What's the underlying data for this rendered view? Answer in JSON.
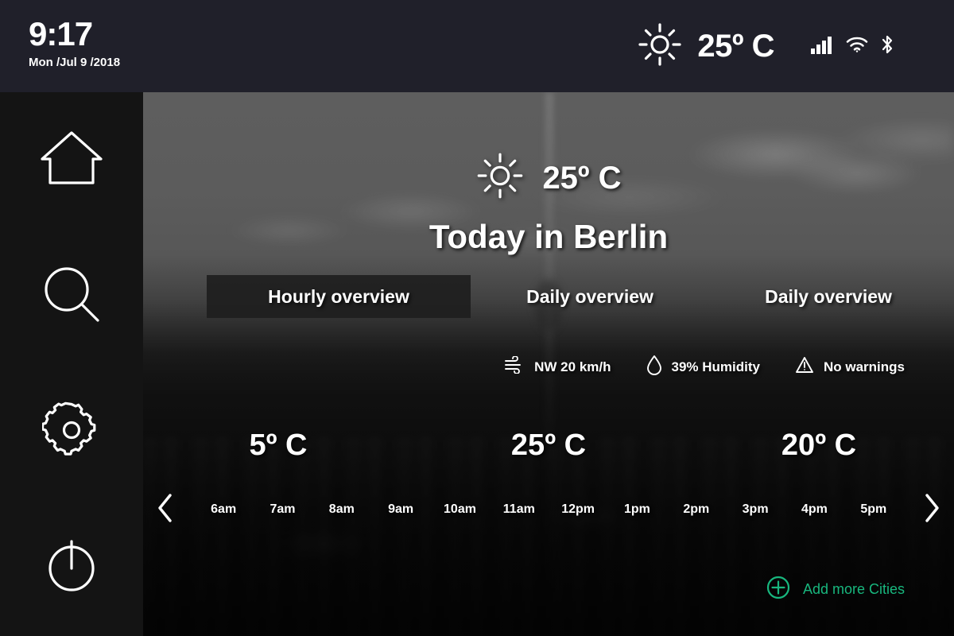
{
  "statusbar": {
    "time": "9:17",
    "date": "Mon /Jul 9 /2018",
    "weather_icon": "sun-icon",
    "temperature": "25º C",
    "icons": [
      "signal-bars-icon",
      "wifi-icon",
      "bluetooth-icon"
    ]
  },
  "sidebar": {
    "items": [
      {
        "name": "home",
        "icon": "home-icon"
      },
      {
        "name": "search",
        "icon": "search-icon"
      },
      {
        "name": "settings",
        "icon": "gear-icon"
      },
      {
        "name": "power",
        "icon": "power-icon"
      }
    ]
  },
  "hero": {
    "weather_icon": "sun-icon",
    "temperature": "25º C",
    "title": "Today in Berlin"
  },
  "tabs": [
    {
      "label": "Hourly overview",
      "active": true
    },
    {
      "label": "Daily overview",
      "active": false
    },
    {
      "label": "Daily overview",
      "active": false
    }
  ],
  "meta": [
    {
      "icon": "wind-icon",
      "text": "NW 20 km/h"
    },
    {
      "icon": "droplet-icon",
      "text": "39% Humidity"
    },
    {
      "icon": "warning-triangle-icon",
      "text": "No warnings"
    }
  ],
  "forecast": {
    "temperatures": [
      "5º C",
      "25º C",
      "20º C"
    ],
    "prev_icon": "chevron-left-icon",
    "next_icon": "chevron-right-icon",
    "hours": [
      "6am",
      "7am",
      "8am",
      "9am",
      "10am",
      "11am",
      "12pm",
      "1pm",
      "2pm",
      "3pm",
      "4pm",
      "5pm"
    ]
  },
  "add_cities": {
    "icon": "plus-circle-icon",
    "label": "Add more Cities"
  },
  "colors": {
    "statusbar_bg": "#20202a",
    "sidebar_bg": "#141414",
    "accent_green": "#18b77e",
    "text": "#ffffff",
    "active_tab_bg": "#1e1e1e"
  }
}
